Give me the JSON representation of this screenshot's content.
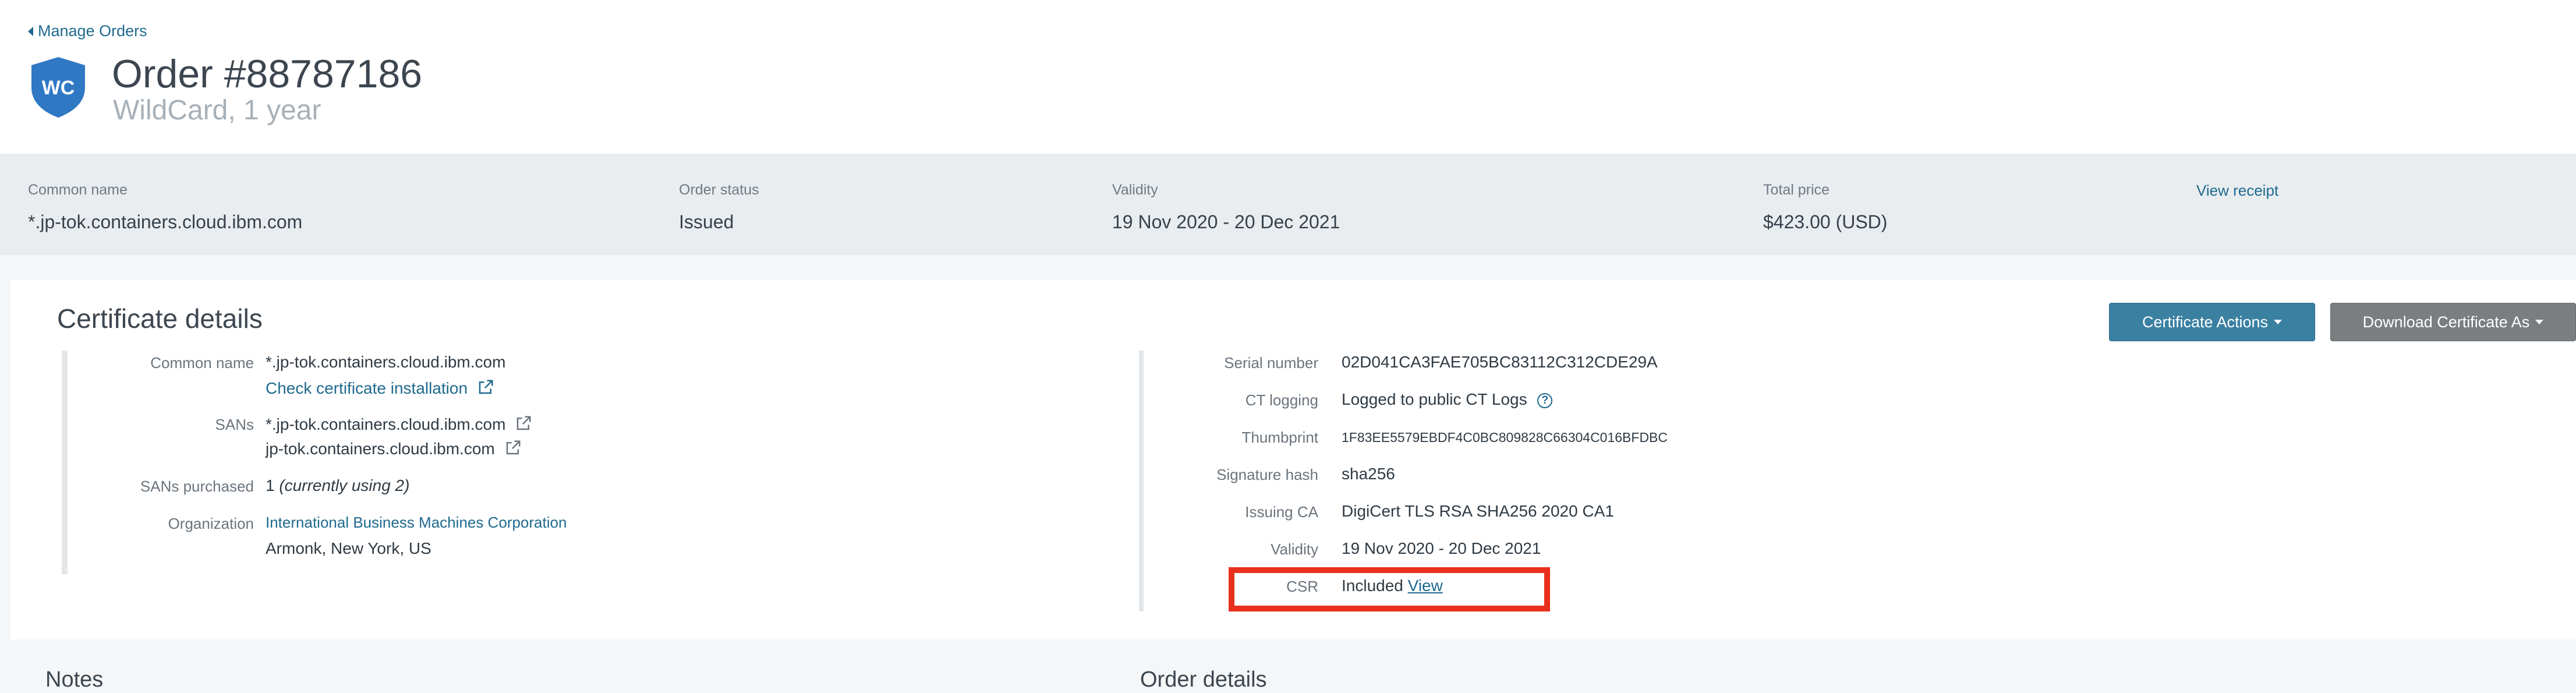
{
  "breadcrumb": {
    "label": "Manage Orders"
  },
  "product": {
    "badge": "WC",
    "badge_color": "#2f78c4",
    "title": "Order #88787186",
    "subtitle": "WildCard, 1 year"
  },
  "summary": {
    "common_name": {
      "label": "Common name",
      "value": "*.jp-tok.containers.cloud.ibm.com"
    },
    "order_status": {
      "label": "Order status",
      "value": "Issued"
    },
    "validity": {
      "label": "Validity",
      "value": "19 Nov 2020 - 20 Dec 2021"
    },
    "total_price": {
      "label": "Total price",
      "value": "$423.00 (USD)"
    },
    "receipt_link": "View receipt"
  },
  "certificate": {
    "title": "Certificate details",
    "actions_button": "Certificate Actions",
    "download_button": "Download Certificate As",
    "left": {
      "common_name_label": "Common name",
      "common_name_value": "*.jp-tok.containers.cloud.ibm.com",
      "check_install_link": "Check certificate installation",
      "sans_label": "SANs",
      "sans": [
        "*.jp-tok.containers.cloud.ibm.com",
        "jp-tok.containers.cloud.ibm.com"
      ],
      "sans_purchased_label": "SANs purchased",
      "sans_purchased_value": "1",
      "sans_purchased_note": "(currently using 2)",
      "organization_label": "Organization",
      "organization_link": "International Business Machines Corporation",
      "organization_location": "Armonk, New York, US"
    },
    "right": {
      "serial_label": "Serial number",
      "serial_value": "02D041CA3FAE705BC83112C312CDE29A",
      "ct_label": "CT logging",
      "ct_value": "Logged to public CT Logs",
      "thumbprint_label": "Thumbprint",
      "thumbprint_value": "1F83EE5579EBDF4C0BC809828C66304C016BFDBC",
      "sig_label": "Signature hash",
      "sig_value": "sha256",
      "issuing_label": "Issuing CA",
      "issuing_value": "DigiCert TLS RSA SHA256 2020 CA1",
      "validity_label": "Validity",
      "validity_value": "19 Nov 2020 - 20 Dec 2021",
      "csr_label": "CSR",
      "csr_value": "Included",
      "csr_link": "View"
    }
  },
  "sections": {
    "notes": "Notes",
    "order_details": "Order details"
  },
  "colors": {
    "link": "#1f6a8e",
    "primary_button": "#3a80a1",
    "secondary_button": "#7b7e80",
    "highlight": "#e8301c"
  },
  "icons": [
    "chevron-left-icon",
    "wildcard-shield-icon",
    "external-link-icon",
    "help-circle-icon",
    "caret-down-icon"
  ]
}
